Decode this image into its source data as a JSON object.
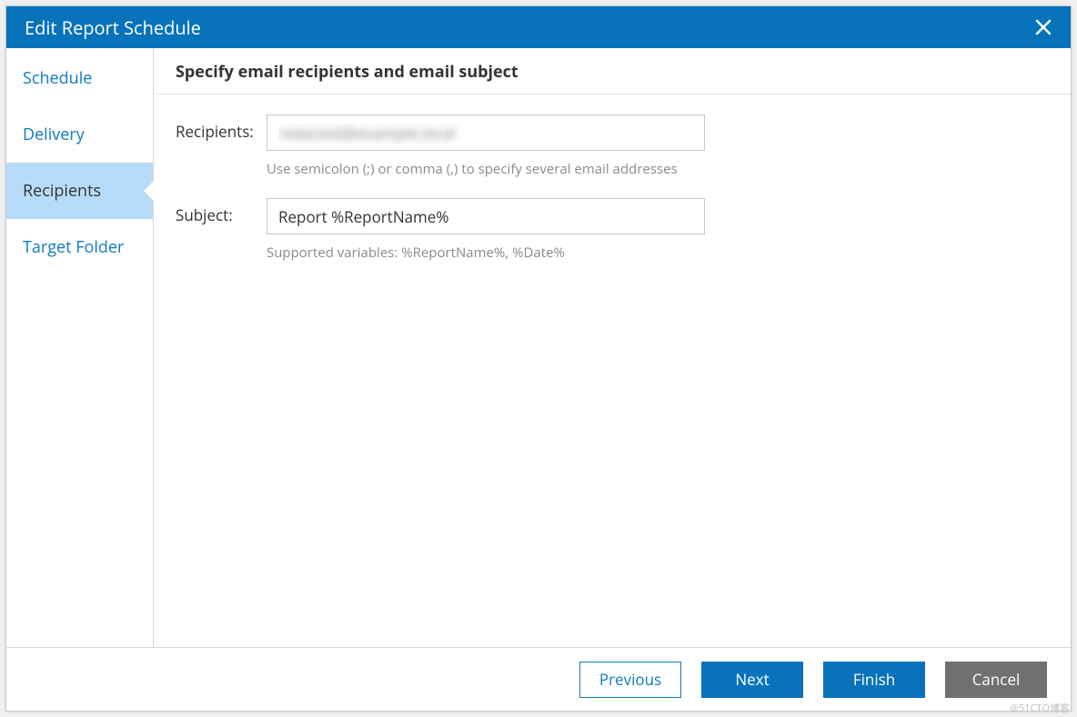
{
  "dialog": {
    "title": "Edit Report Schedule"
  },
  "sidebar": {
    "items": [
      {
        "label": "Schedule",
        "active": false
      },
      {
        "label": "Delivery",
        "active": false
      },
      {
        "label": "Recipients",
        "active": true
      },
      {
        "label": "Target Folder",
        "active": false
      }
    ]
  },
  "main": {
    "heading": "Specify email recipients and email subject",
    "recipients": {
      "label": "Recipients:",
      "value": "redacted@example.local",
      "helper": "Use semicolon (;) or comma (,) to specify several email addresses"
    },
    "subject": {
      "label": "Subject:",
      "value": "Report %ReportName%",
      "helper": "Supported variables: %ReportName%, %Date%"
    }
  },
  "footer": {
    "previous": "Previous",
    "next": "Next",
    "finish": "Finish",
    "cancel": "Cancel"
  },
  "watermark": "@51CTO博客"
}
